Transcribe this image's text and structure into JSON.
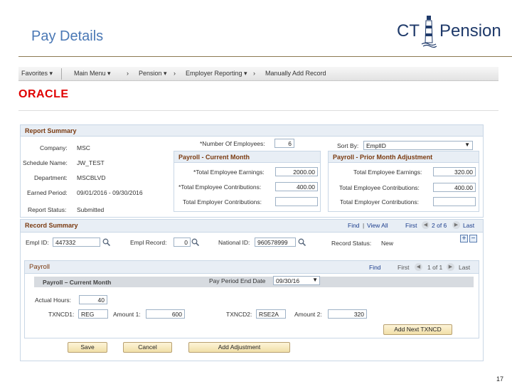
{
  "slide": {
    "title": "Pay Details",
    "page_number": "17"
  },
  "logo": {
    "left_text": "CT",
    "right_text": "Pension"
  },
  "menubar": {
    "favorites": "Favorites ▾",
    "main_menu": "Main Menu ▾",
    "pension": "Pension ▾",
    "employer_reporting": "Employer Reporting ▾",
    "manually_add_record": "Manually Add Record",
    "sep_1": "›",
    "sep_2": "›",
    "sep_3": "›",
    "sep_4": "›"
  },
  "brand": "ORACLE",
  "report_summary": {
    "header": "Report Summary",
    "company_label": "Company:",
    "company": "MSC",
    "schedule_label": "Schedule Name:",
    "schedule": "JW_TEST",
    "department_label": "Department:",
    "department": "MSCBLVD",
    "earned_label": "Earned Period:",
    "earned": "09/01/2016 - 09/30/2016",
    "status_label": "Report Status:",
    "status": "Submitted",
    "num_emp_label": "*Number Of Employees:",
    "num_emp": "6",
    "sort_by_label": "Sort By:",
    "sort_by": "EmplID"
  },
  "payroll_current": {
    "header": "Payroll - Current Month",
    "earnings_label": "*Total Employee Earnings:",
    "earnings": "2000.00",
    "contrib_label": "*Total Employee Contributions:",
    "contrib": "400.00",
    "employer_label": "Total Employer Contributions:",
    "employer": ""
  },
  "payroll_prior": {
    "header": "Payroll - Prior Month Adjustment",
    "earnings_label": "Total Employee Earnings:",
    "earnings": "320.00",
    "contrib_label": "Total Employee Contributions:",
    "contrib": "400.00",
    "employer_label": "Total Employer Contributions:",
    "employer": ""
  },
  "record_summary": {
    "header": "Record Summary",
    "find": "Find",
    "pipe": "|",
    "view_all": "View All",
    "first": "First",
    "pager": "2 of 6",
    "last": "Last",
    "empl_id_label": "Empl ID:",
    "empl_id": "447332",
    "empl_record_label": "Empl Record:",
    "empl_record": "0",
    "national_id_label": "National ID:",
    "national_id": "960578999",
    "record_status_label": "Record Status:",
    "record_status": "New",
    "add_row": "+",
    "delete_row": "−"
  },
  "payroll": {
    "header": "Payroll",
    "find": "Find",
    "first": "First",
    "pager": "1 of 1",
    "last": "Last",
    "sub_header": "Payroll – Current Month",
    "end_date_label": "Pay Period End Date",
    "end_date": "09/30/16",
    "hours_label": "Actual Hours:",
    "hours": "40",
    "txncd1_label": "TXNCD1:",
    "txncd1": "REG",
    "amount1_label": "Amount 1:",
    "amount1": "600",
    "txncd2_label": "TXNCD2:",
    "txncd2": "RSE2A",
    "amount2_label": "Amount 2:",
    "amount2": "320",
    "add_next": "Add Next TXNCD"
  },
  "actions": {
    "save": "Save",
    "cancel": "Cancel",
    "add_adjustment": "Add Adjustment"
  }
}
